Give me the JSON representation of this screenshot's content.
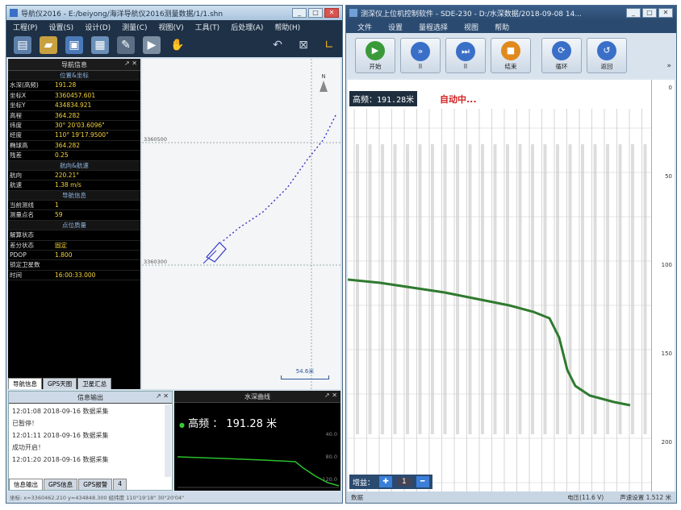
{
  "left_window": {
    "title": "导航仪2016 - E:/beiyong/海洋导航仪2016测量数据/1/1.shn",
    "menu": [
      "工程(P)",
      "设置(S)",
      "设计(D)",
      "测量(C)",
      "视图(V)",
      "工具(T)",
      "后处理(A)",
      "帮助(H)"
    ],
    "nav_panel": {
      "header": "导航信息",
      "rows": [
        {
          "type": "section",
          "label": "位置&坐标"
        },
        {
          "k": "水深(高频)",
          "v": "191.28"
        },
        {
          "k": "坐标X",
          "v": "3360457.601"
        },
        {
          "k": "坐标Y",
          "v": "434834.921"
        },
        {
          "k": "高程",
          "v": "364.282"
        },
        {
          "k": "纬度",
          "v": "30° 20'03.6096\""
        },
        {
          "k": "经度",
          "v": "110° 19'17.9500\""
        },
        {
          "k": "椭球高",
          "v": "364.282"
        },
        {
          "k": "残差",
          "v": "0.25"
        },
        {
          "type": "section",
          "label": "航向&航速"
        },
        {
          "k": "航向",
          "v": "220.21°"
        },
        {
          "k": "航速",
          "v": "1.38 m/s"
        },
        {
          "type": "section",
          "label": "导航信息"
        },
        {
          "k": "当前测线",
          "v": "1"
        },
        {
          "k": "测量点名",
          "v": "59"
        },
        {
          "type": "section",
          "label": "点位质量"
        },
        {
          "k": "解算状态",
          "v": ""
        },
        {
          "k": "差分状态",
          "v": "固定"
        },
        {
          "k": "PDOP",
          "v": "1.800"
        },
        {
          "k": "锁定卫星数",
          "v": ""
        },
        {
          "k": "时间",
          "v": "16:00:33.000"
        }
      ],
      "tabs": [
        "导航信息",
        "GPS天图",
        "卫星汇总"
      ]
    },
    "map": {
      "grid_label_top": "3360500",
      "grid_label_mid": "3360300",
      "compass_label": "N",
      "scale_label": "54.6米"
    },
    "info_panel": {
      "header": "信息输出",
      "lines": [
        "12:01:08 2018-09-16  数据采集",
        "已暂停！",
        "12:01:11 2018-09-16  数据采集",
        "成功开启！",
        "12:01:20 2018-09-16  数据采集"
      ],
      "tabs": [
        "信息输出",
        "GPS信息",
        "GPS报警",
        "4"
      ]
    },
    "depth_panel": {
      "header": "水深曲线",
      "reading": "高频 ： 191.28 米",
      "axis_labels": [
        "40.0",
        "80.0",
        "120.0"
      ]
    },
    "status_text": "坐标: x=3360462.210 y=434848.300  经纬度 110°19'18\" 30°20'04\""
  },
  "right_window": {
    "title": "测深仪上位机控制软件 - SDE-230 - D:/水深数据/2018-09-08 14...",
    "menu": [
      "文件",
      "设置",
      "量程选择",
      "视图",
      "帮助"
    ],
    "buttons": [
      {
        "label": "开始",
        "icon": "play",
        "color": "#3a9a3a"
      },
      {
        "label": "ll",
        "icon": "fast-forward",
        "color": "#3a6fc8"
      },
      {
        "label": "ll",
        "icon": "skip-forward",
        "color": "#3a6fc8"
      },
      {
        "label": "结束",
        "icon": "stop",
        "color": "#e08a1e"
      },
      {
        "label": "循环",
        "icon": "refresh",
        "color": "#3a6fc8"
      },
      {
        "label": "返回",
        "icon": "undo",
        "color": "#3a6fc8"
      }
    ],
    "high_freq_label": "高频：191.28米",
    "status_text": "自动中...",
    "ruler_labels": [
      "0",
      "50",
      "100",
      "150",
      "200"
    ],
    "gain_label": "增益：",
    "gain_value": "1",
    "status": {
      "left": "数据",
      "mid": "电压(11.6 V)",
      "right": "声速设置  1.512 米"
    }
  },
  "colors": {
    "accent": "#2b5797",
    "trace": "#2f7a2f",
    "alarm": "#d02020"
  }
}
